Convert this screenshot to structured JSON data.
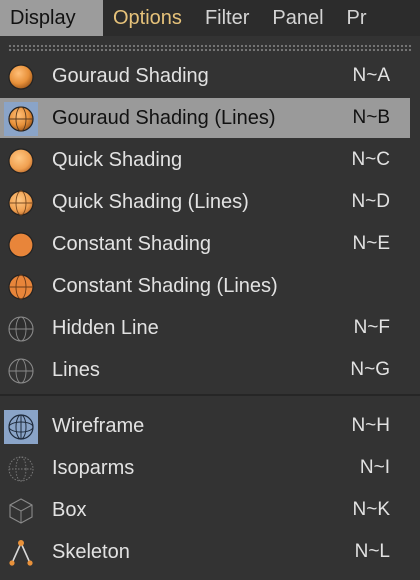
{
  "menubar": {
    "items": [
      "Display",
      "Options",
      "Filter",
      "Panel",
      "Pr"
    ]
  },
  "menu": {
    "items": [
      {
        "label": "Gouraud Shading",
        "shortcut": "N~A",
        "icon": "gouraud-shading-icon"
      },
      {
        "label": "Gouraud Shading (Lines)",
        "shortcut": "N~B",
        "icon": "gouraud-shading-lines-icon",
        "selected": true
      },
      {
        "label": "Quick Shading",
        "shortcut": "N~C",
        "icon": "quick-shading-icon"
      },
      {
        "label": "Quick Shading (Lines)",
        "shortcut": "N~D",
        "icon": "quick-shading-lines-icon"
      },
      {
        "label": "Constant Shading",
        "shortcut": "N~E",
        "icon": "constant-shading-icon"
      },
      {
        "label": "Constant Shading (Lines)",
        "shortcut": "",
        "icon": "constant-shading-lines-icon"
      },
      {
        "label": "Hidden Line",
        "shortcut": "N~F",
        "icon": "hidden-line-icon"
      },
      {
        "label": "Lines",
        "shortcut": "N~G",
        "icon": "lines-icon"
      },
      {
        "label": "Wireframe",
        "shortcut": "N~H",
        "icon": "wireframe-icon",
        "active": true
      },
      {
        "label": "Isoparms",
        "shortcut": "N~I",
        "icon": "isoparms-icon"
      },
      {
        "label": "Box",
        "shortcut": "N~K",
        "icon": "box-icon"
      },
      {
        "label": "Skeleton",
        "shortcut": "N~L",
        "icon": "skeleton-icon"
      }
    ]
  },
  "colors": {
    "background": "#333333",
    "menubar": "#2c2c2c",
    "selected_row": "#9a9a9a",
    "accent_text": "#e6c27a",
    "icon_highlight": "#8aa4c8",
    "sphere_orange": "#e8913a"
  }
}
